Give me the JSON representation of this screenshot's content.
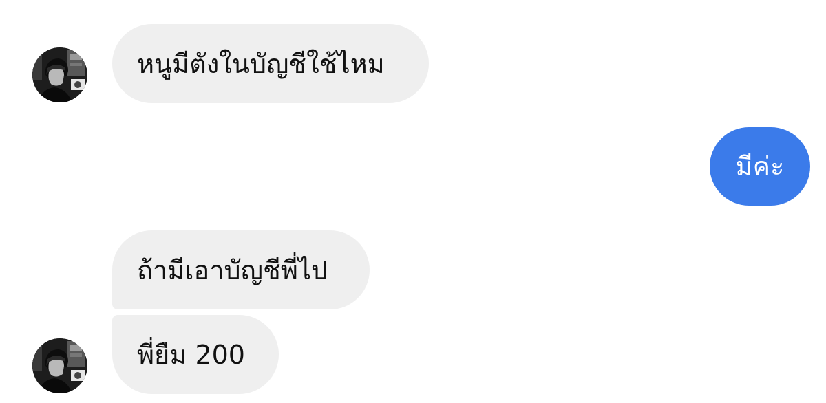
{
  "colors": {
    "incoming_bubble": "#efefef",
    "outgoing_bubble": "#3b7bea",
    "incoming_text": "#111111",
    "outgoing_text": "#ffffff"
  },
  "messages": [
    {
      "direction": "incoming",
      "text": "หนูมีตังในบัญชีใช้ไหม"
    },
    {
      "direction": "outgoing",
      "text": "มีค่ะ"
    },
    {
      "direction": "incoming",
      "text": "ถ้ามีเอาบัญชีพี่ไป"
    },
    {
      "direction": "incoming",
      "text": "พี่ยืม 200"
    }
  ],
  "avatar": {
    "icon": "profile-photo"
  }
}
